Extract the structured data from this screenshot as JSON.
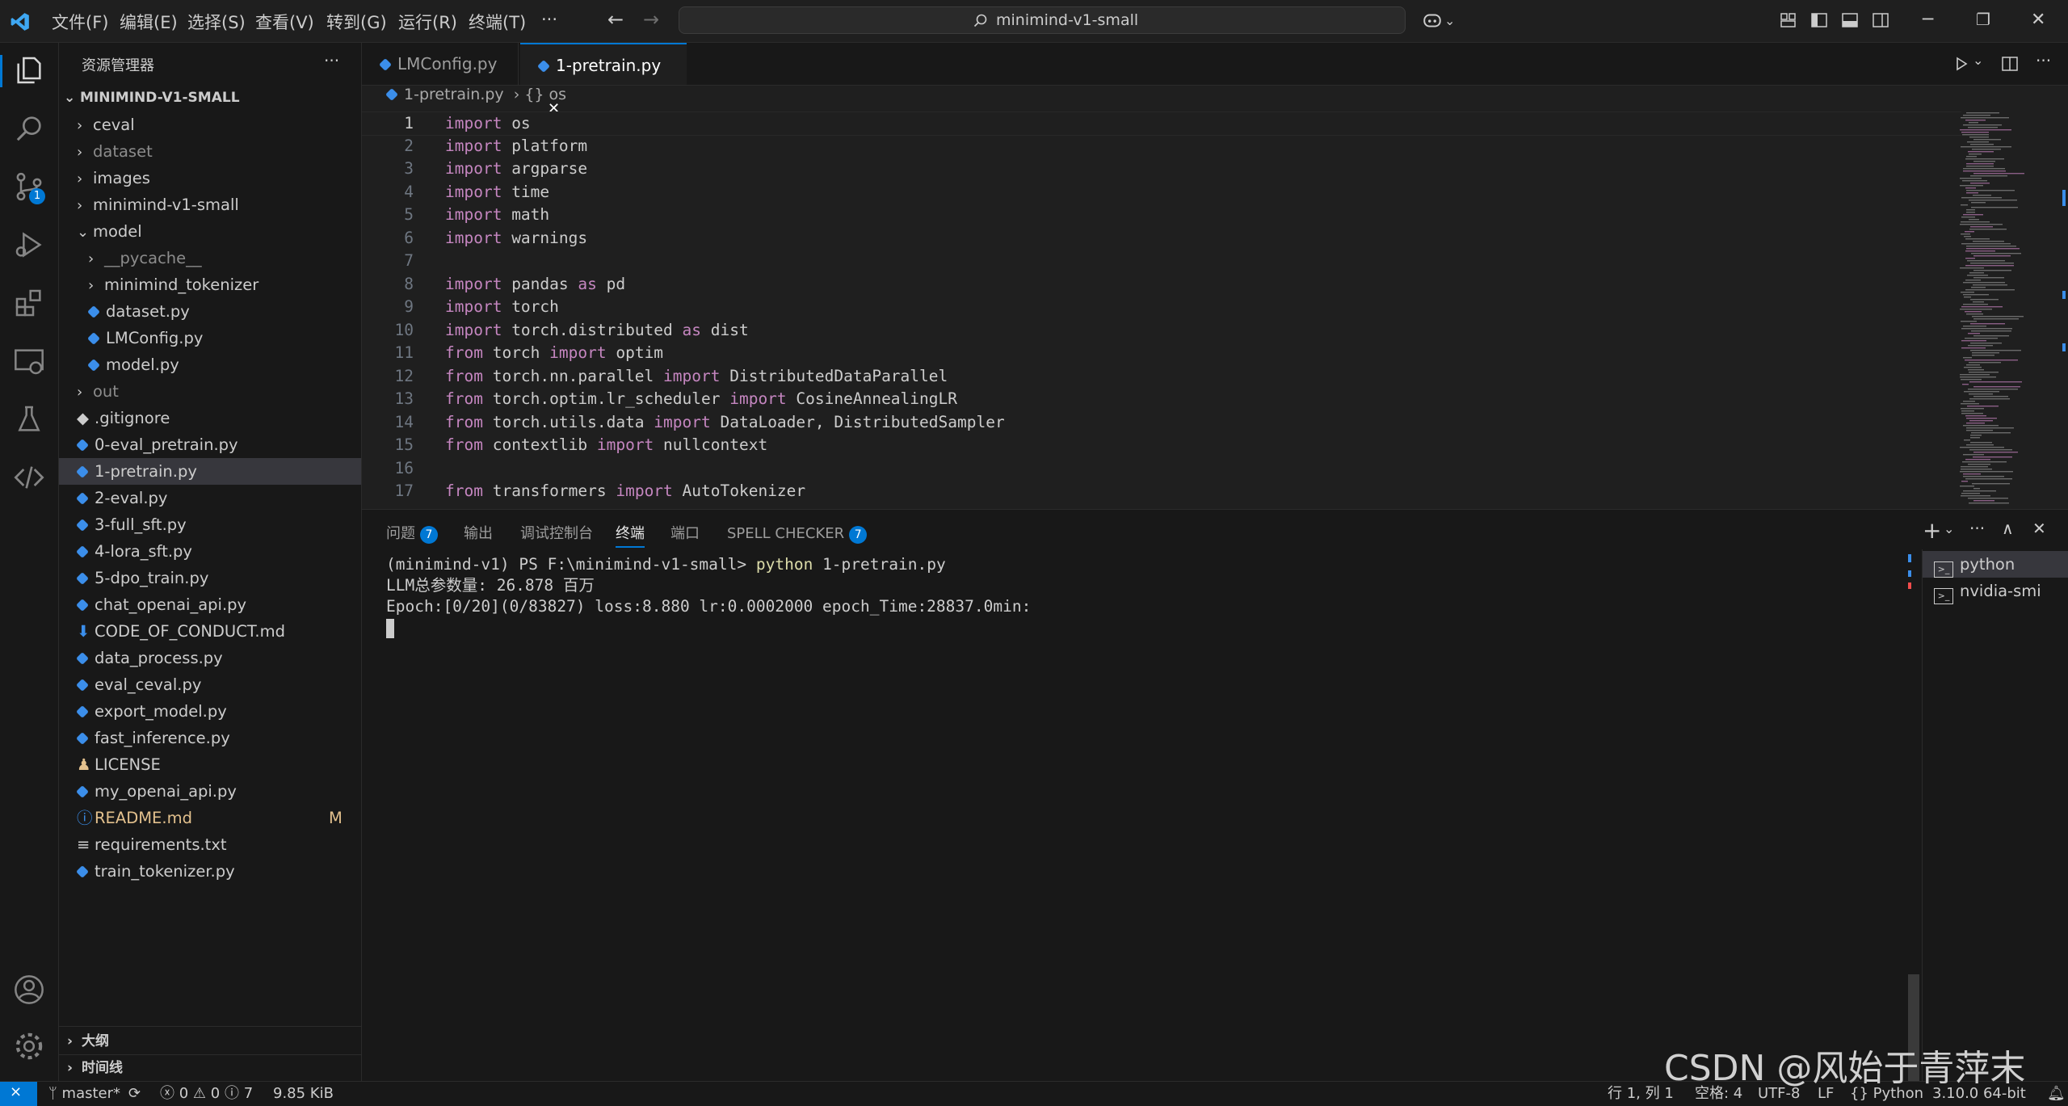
{
  "titlebar": {
    "menus": [
      "文件(F)",
      "编辑(E)",
      "选择(S)",
      "查看(V)",
      "转到(G)",
      "运行(R)",
      "终端(T)",
      "···"
    ],
    "search_text": "minimind-v1-small"
  },
  "sidebar": {
    "title": "资源管理器",
    "more": "···",
    "root": "MINIMIND-V1-SMALL",
    "items": [
      {
        "label": "ceval",
        "kind": "folder",
        "open": false,
        "depth": 0,
        "dim": false
      },
      {
        "label": "dataset",
        "kind": "folder",
        "open": false,
        "depth": 0,
        "dim": true
      },
      {
        "label": "images",
        "kind": "folder",
        "open": false,
        "depth": 0,
        "dim": false
      },
      {
        "label": "minimind-v1-small",
        "kind": "folder",
        "open": false,
        "depth": 0,
        "dim": false
      },
      {
        "label": "model",
        "kind": "folder",
        "open": true,
        "depth": 0,
        "dim": false
      },
      {
        "label": "__pycache__",
        "kind": "folder",
        "open": false,
        "depth": 1,
        "dim": true
      },
      {
        "label": "minimind_tokenizer",
        "kind": "folder",
        "open": false,
        "depth": 1,
        "dim": false
      },
      {
        "label": "dataset.py",
        "kind": "py",
        "depth": 1,
        "dim": false
      },
      {
        "label": "LMConfig.py",
        "kind": "py",
        "depth": 1,
        "dim": false
      },
      {
        "label": "model.py",
        "kind": "py",
        "depth": 1,
        "dim": false
      },
      {
        "label": "out",
        "kind": "folder",
        "open": false,
        "depth": 0,
        "dim": true
      },
      {
        "label": ".gitignore",
        "kind": "git",
        "depth": 0,
        "dim": false
      },
      {
        "label": "0-eval_pretrain.py",
        "kind": "py",
        "depth": 0,
        "dim": false
      },
      {
        "label": "1-pretrain.py",
        "kind": "py",
        "depth": 0,
        "dim": false,
        "selected": true
      },
      {
        "label": "2-eval.py",
        "kind": "py",
        "depth": 0,
        "dim": false
      },
      {
        "label": "3-full_sft.py",
        "kind": "py",
        "depth": 0,
        "dim": false
      },
      {
        "label": "4-lora_sft.py",
        "kind": "py",
        "depth": 0,
        "dim": false
      },
      {
        "label": "5-dpo_train.py",
        "kind": "py",
        "depth": 0,
        "dim": false
      },
      {
        "label": "chat_openai_api.py",
        "kind": "py",
        "depth": 0,
        "dim": false
      },
      {
        "label": "CODE_OF_CONDUCT.md",
        "kind": "md",
        "depth": 0,
        "dim": false
      },
      {
        "label": "data_process.py",
        "kind": "py",
        "depth": 0,
        "dim": false
      },
      {
        "label": "eval_ceval.py",
        "kind": "py",
        "depth": 0,
        "dim": false
      },
      {
        "label": "export_model.py",
        "kind": "py",
        "depth": 0,
        "dim": false
      },
      {
        "label": "fast_inference.py",
        "kind": "py",
        "depth": 0,
        "dim": false
      },
      {
        "label": "LICENSE",
        "kind": "license",
        "depth": 0,
        "dim": false
      },
      {
        "label": "my_openai_api.py",
        "kind": "py",
        "depth": 0,
        "dim": false
      },
      {
        "label": "README.md",
        "kind": "info",
        "depth": 0,
        "dim": false,
        "modified": "M"
      },
      {
        "label": "requirements.txt",
        "kind": "txt",
        "depth": 0,
        "dim": false
      },
      {
        "label": "train_tokenizer.py",
        "kind": "py",
        "depth": 0,
        "dim": false
      }
    ],
    "outline": "大纲",
    "timeline": "时间线"
  },
  "tabs": [
    {
      "label": "LMConfig.py",
      "active": false
    },
    {
      "label": "1-pretrain.py",
      "active": true
    }
  ],
  "breadcrumb": {
    "file": "1-pretrain.py",
    "symbol": "{} os"
  },
  "code": [
    [
      [
        "kw",
        "import"
      ],
      [
        "t",
        " os"
      ]
    ],
    [
      [
        "kw",
        "import"
      ],
      [
        "t",
        " platform"
      ]
    ],
    [
      [
        "kw",
        "import"
      ],
      [
        "t",
        " argparse"
      ]
    ],
    [
      [
        "kw",
        "import"
      ],
      [
        "t",
        " time"
      ]
    ],
    [
      [
        "kw",
        "import"
      ],
      [
        "t",
        " math"
      ]
    ],
    [
      [
        "kw",
        "import"
      ],
      [
        "t",
        " warnings"
      ]
    ],
    [],
    [
      [
        "kw",
        "import"
      ],
      [
        "t",
        " pandas "
      ],
      [
        "kw",
        "as"
      ],
      [
        "t",
        " pd"
      ]
    ],
    [
      [
        "kw",
        "import"
      ],
      [
        "t",
        " torch"
      ]
    ],
    [
      [
        "kw",
        "import"
      ],
      [
        "t",
        " torch.distributed "
      ],
      [
        "kw",
        "as"
      ],
      [
        "t",
        " dist"
      ]
    ],
    [
      [
        "kw",
        "from"
      ],
      [
        "t",
        " torch "
      ],
      [
        "kw",
        "import"
      ],
      [
        "t",
        " optim"
      ]
    ],
    [
      [
        "kw",
        "from"
      ],
      [
        "t",
        " torch.nn.parallel "
      ],
      [
        "kw",
        "import"
      ],
      [
        "t",
        " DistributedDataParallel"
      ]
    ],
    [
      [
        "kw",
        "from"
      ],
      [
        "t",
        " torch.optim.lr_scheduler "
      ],
      [
        "kw",
        "import"
      ],
      [
        "t",
        " CosineAnnealingLR"
      ]
    ],
    [
      [
        "kw",
        "from"
      ],
      [
        "t",
        " torch.utils.data "
      ],
      [
        "kw",
        "import"
      ],
      [
        "t",
        " DataLoader, DistributedSampler"
      ]
    ],
    [
      [
        "kw",
        "from"
      ],
      [
        "t",
        " contextlib "
      ],
      [
        "kw",
        "import"
      ],
      [
        "t",
        " nullcontext"
      ]
    ],
    [],
    [
      [
        "kw",
        "from"
      ],
      [
        "t",
        " transformers "
      ],
      [
        "kw",
        "import"
      ],
      [
        "t",
        " AutoTokenizer"
      ]
    ]
  ],
  "panel": {
    "tabs": [
      {
        "label": "问题",
        "badge": "7"
      },
      {
        "label": "输出"
      },
      {
        "label": "调试控制台"
      },
      {
        "label": "终端",
        "active": true
      },
      {
        "label": "端口"
      },
      {
        "label": "SPELL CHECKER",
        "badge": "7"
      }
    ],
    "terminal_prompt": "(minimind-v1) PS F:\\minimind-v1-small> ",
    "terminal_cmd": "python",
    "terminal_cmd_arg": " 1-pretrain.py",
    "terminal_lines": [
      "LLM总参数量: 26.878 百万",
      "Epoch:[0/20](0/83827) loss:8.880 lr:0.0002000 epoch_Time:28837.0min:"
    ],
    "terminals": [
      {
        "label": "python",
        "active": true
      },
      {
        "label": "nvidia-smi",
        "active": false
      }
    ]
  },
  "statusbar": {
    "branch": "master*",
    "errors": "0",
    "warnings": "0",
    "info": "7",
    "size": "9.85 KiB",
    "position": "行 1, 列 1",
    "spaces": "空格: 4",
    "encoding": "UTF-8",
    "eol": "LF",
    "language": "Python",
    "interpreter": "3.10.0 64-bit"
  },
  "watermark": "CSDN @风始于青萍末",
  "colors": {
    "accent": "#0078d4",
    "keyword": "#c586c0",
    "modified": "#e2c08d"
  }
}
